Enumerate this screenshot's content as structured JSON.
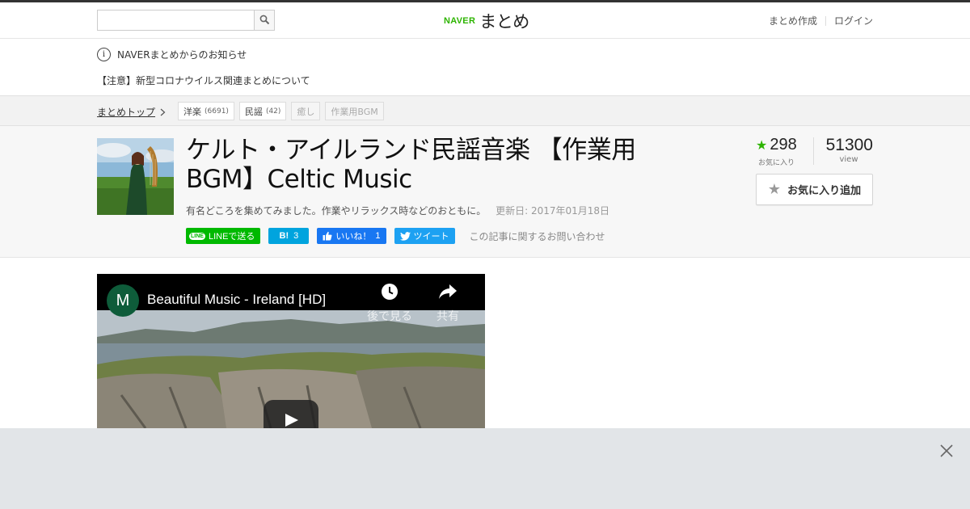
{
  "header": {
    "search_placeholder": "",
    "logo_brand": "NAVER",
    "logo_service": "まとめ",
    "links": [
      "まとめ作成",
      "ログイン"
    ]
  },
  "notice": {
    "title": "NAVERまとめからのお知らせ",
    "item": "【注意】新型コロナウイルス関連まとめについて"
  },
  "breadcrumb": {
    "home": "まとめトップ",
    "tags": [
      {
        "label": "洋楽",
        "count": "(6691)"
      },
      {
        "label": "民謡",
        "count": "(42)"
      },
      {
        "label": "癒し",
        "count": ""
      },
      {
        "label": "作業用BGM",
        "count": ""
      }
    ]
  },
  "article": {
    "title": "ケルト・アイルランド民謡音楽 【作業用BGM】Celtic Music",
    "description": "有名どころを集めてみました。作業やリラックス時などのおともに。",
    "updated": "更新日: 2017年01月18日",
    "share": {
      "line_badge": "LINE",
      "line_label": "LINEで送る",
      "hatena_label": "B!",
      "hatena_count": "3",
      "fb_label": "いいね！",
      "fb_count": "1",
      "tweet_label": "ツイート"
    },
    "contact": "この記事に関するお問い合わせ",
    "favorites": "298",
    "favorites_label": "お気に入り",
    "views": "51300",
    "views_label": "view",
    "fav_button": "お気に入り追加"
  },
  "video": {
    "channel_initial": "M",
    "title": "Beautiful Music - Ireland [HD]",
    "watch_later": "後で見る",
    "share": "共有"
  },
  "colors": {
    "naver_green": "#2db400",
    "line_green": "#00b900",
    "hatena_blue": "#00a4de",
    "facebook_blue": "#1877f2",
    "twitter_blue": "#1da1f2"
  }
}
